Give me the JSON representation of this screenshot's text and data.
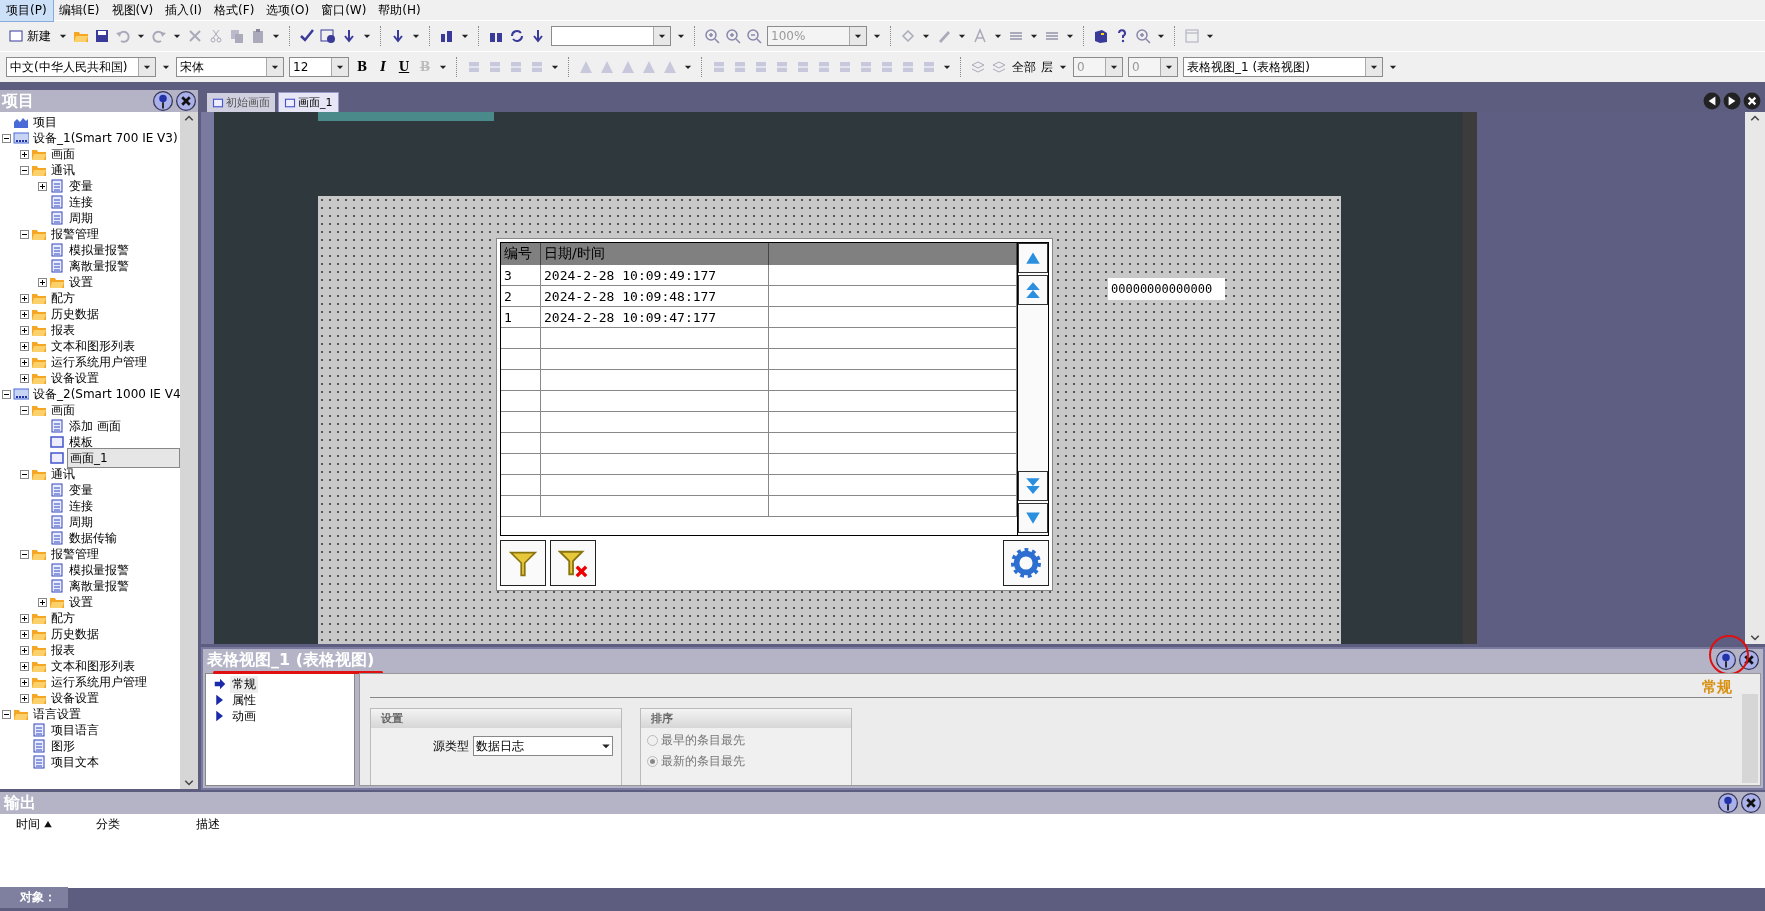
{
  "menu": [
    {
      "label": "项目(P)",
      "selected": true
    },
    {
      "label": "编辑(E)",
      "selected": false
    },
    {
      "label": "视图(V)",
      "selected": false
    },
    {
      "label": "插入(I)",
      "selected": false
    },
    {
      "label": "格式(F)",
      "selected": false
    },
    {
      "label": "选项(O)",
      "selected": false
    },
    {
      "label": "窗口(W)",
      "selected": false
    },
    {
      "label": "帮助(H)",
      "selected": false
    }
  ],
  "toolbar": {
    "new_button": "新建",
    "zoom_combo": {
      "value": "100%",
      "disabled": true
    }
  },
  "format_toolbar": {
    "language": "中文(中华人民共和国)",
    "font": "宋体",
    "size": "12",
    "styles": [
      {
        "label": "B",
        "kind": "bold",
        "disabled": false
      },
      {
        "label": "I",
        "kind": "italic",
        "disabled": false
      },
      {
        "label": "U",
        "kind": "underline",
        "disabled": false
      },
      {
        "label": "B",
        "kind": "strike",
        "disabled": true
      }
    ],
    "layer_all": "全部",
    "layer": "层",
    "spin_1": "0",
    "spin_2": "0",
    "object": "表格视图_1 (表格视图)"
  },
  "project_panel": {
    "title": "项目",
    "tree": [
      {
        "label": "项目",
        "kind": "root",
        "selected": false
      },
      {
        "label": "设备_1(Smart 700 IE V3)",
        "kind": "device",
        "expanded": true,
        "selected": false,
        "children": [
          {
            "label": "画面",
            "kind": "folder",
            "expanded": false,
            "selected": false
          },
          {
            "label": "通讯",
            "kind": "folder",
            "expanded": true,
            "selected": false,
            "children": [
              {
                "label": "变量",
                "kind": "item",
                "expanded": false,
                "selected": false
              },
              {
                "label": "连接",
                "kind": "item",
                "selected": false
              },
              {
                "label": "周期",
                "kind": "item",
                "selected": false
              }
            ]
          },
          {
            "label": "报警管理",
            "kind": "folder",
            "expanded": true,
            "selected": false,
            "children": [
              {
                "label": "模拟量报警",
                "kind": "item",
                "selected": false
              },
              {
                "label": "离散量报警",
                "kind": "item",
                "selected": false
              },
              {
                "label": "设置",
                "kind": "folder",
                "expanded": false,
                "selected": false
              }
            ]
          },
          {
            "label": "配方",
            "kind": "folder",
            "expanded": false,
            "selected": false
          },
          {
            "label": "历史数据",
            "kind": "folder",
            "expanded": false,
            "selected": false
          },
          {
            "label": "报表",
            "kind": "folder",
            "expanded": false,
            "selected": false
          },
          {
            "label": "文本和图形列表",
            "kind": "folder",
            "expanded": false,
            "selected": false
          },
          {
            "label": "运行系统用户管理",
            "kind": "folder",
            "expanded": false,
            "selected": false
          },
          {
            "label": "设备设置",
            "kind": "folder",
            "expanded": false,
            "selected": false
          }
        ]
      },
      {
        "label": "设备_2(Smart 1000 IE V4",
        "kind": "device",
        "expanded": true,
        "selected": false,
        "children": [
          {
            "label": "画面",
            "kind": "folder",
            "expanded": true,
            "selected": false,
            "children": [
              {
                "label": "添加 画面",
                "kind": "item",
                "selected": false
              },
              {
                "label": "模板",
                "kind": "screen",
                "selected": false
              },
              {
                "label": "画面_1",
                "kind": "screen",
                "selected": true
              }
            ]
          },
          {
            "label": "通讯",
            "kind": "folder",
            "expanded": true,
            "selected": false,
            "children": [
              {
                "label": "变量",
                "kind": "item",
                "selected": false
              },
              {
                "label": "连接",
                "kind": "item",
                "selected": false
              },
              {
                "label": "周期",
                "kind": "item",
                "selected": false
              },
              {
                "label": "数据传输",
                "kind": "item",
                "selected": false
              }
            ]
          },
          {
            "label": "报警管理",
            "kind": "folder",
            "expanded": true,
            "selected": false,
            "children": [
              {
                "label": "模拟量报警",
                "kind": "item",
                "selected": false
              },
              {
                "label": "离散量报警",
                "kind": "item",
                "selected": false
              },
              {
                "label": "设置",
                "kind": "folder",
                "expanded": false,
                "selected": false
              }
            ]
          },
          {
            "label": "配方",
            "kind": "folder",
            "expanded": false,
            "selected": false
          },
          {
            "label": "历史数据",
            "kind": "folder",
            "expanded": false,
            "selected": false
          },
          {
            "label": "报表",
            "kind": "folder",
            "expanded": false,
            "selected": false
          },
          {
            "label": "文本和图形列表",
            "kind": "folder",
            "expanded": false,
            "selected": false
          },
          {
            "label": "运行系统用户管理",
            "kind": "folder",
            "expanded": false,
            "selected": false
          },
          {
            "label": "设备设置",
            "kind": "folder",
            "expanded": false,
            "selected": false
          }
        ]
      },
      {
        "label": "语言设置",
        "kind": "folder",
        "expanded": true,
        "selected": false,
        "children": [
          {
            "label": "项目语言",
            "kind": "item",
            "selected": false
          },
          {
            "label": "图形",
            "kind": "item",
            "selected": false
          },
          {
            "label": "项目文本",
            "kind": "item",
            "selected": false
          }
        ]
      }
    ]
  },
  "editor": {
    "tabs": [
      {
        "label": "初始画面",
        "selected": false
      },
      {
        "label": "画面_1",
        "selected": true
      }
    ],
    "table": {
      "columns": [
        "编号",
        "日期/时间"
      ],
      "rows": [
        [
          "3",
          "2024-2-28 10:09:49:177"
        ],
        [
          "2",
          "2024-2-28 10:09:48:177"
        ],
        [
          "1",
          "2024-2-28 10:09:47:177"
        ]
      ]
    },
    "io_field": "00000000000000"
  },
  "properties": {
    "title": "表格视图_1 (表格视图)",
    "nav": [
      {
        "label": "常规",
        "selected": true
      },
      {
        "label": "属性",
        "selected": false
      },
      {
        "label": "动画",
        "selected": false
      }
    ],
    "section_title": "常规",
    "settings": {
      "title": "设置",
      "source_label": "源类型",
      "source_value": "数据日志"
    },
    "sort": {
      "title": "排序",
      "options": [
        {
          "label": "最早的条目最先",
          "selected": false,
          "disabled": true
        },
        {
          "label": "最新的条目最先",
          "selected": true,
          "disabled": true
        }
      ]
    }
  },
  "output": {
    "title": "输出",
    "columns": [
      {
        "label": "时间",
        "sorted": true
      },
      {
        "label": "分类",
        "sorted": false
      },
      {
        "label": "描述",
        "sorted": false
      }
    ]
  },
  "status_bar": {
    "label": "对象："
  }
}
